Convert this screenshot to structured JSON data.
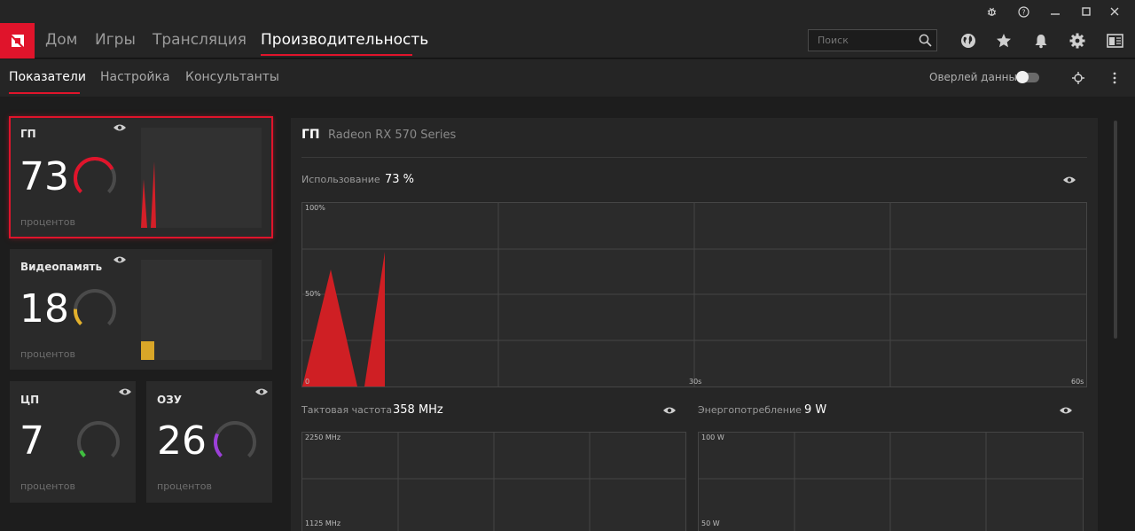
{
  "nav": {
    "items": [
      "Дом",
      "Игры",
      "Трансляция",
      "Производительность"
    ],
    "active": "Производительность"
  },
  "search": {
    "placeholder": "Поиск"
  },
  "subnav": {
    "items": [
      "Показатели",
      "Настройка",
      "Консультанты"
    ],
    "overlay_label": "Оверлей данных"
  },
  "cards": {
    "gpu": {
      "title": "ГП",
      "value": "73",
      "unit": "процентов",
      "percent": 73,
      "color": "#e0142b"
    },
    "vram": {
      "title": "Видеопамять",
      "value": "18",
      "unit": "процентов",
      "percent": 18,
      "color": "#e3b12c"
    },
    "cpu": {
      "title": "ЦП",
      "value": "7",
      "unit": "процентов",
      "percent": 7,
      "color": "#3fbf3f"
    },
    "ram": {
      "title": "ОЗУ",
      "value": "26",
      "unit": "процентов",
      "percent": 26,
      "color": "#9b3fd8"
    }
  },
  "panel": {
    "title": "ГП",
    "device": "Radeon RX 570 Series",
    "usage": {
      "label": "Использование",
      "value": "73 %",
      "y_top": "100%",
      "y_mid": "50%",
      "x_start": "0",
      "x_mid": "30s",
      "x_end": "60s"
    },
    "clock": {
      "label": "Тактовая частота",
      "value": "358 MHz",
      "y_top": "2250 MHz",
      "y_mid": "1125 MHz"
    },
    "power": {
      "label": "Энергопотребление",
      "value": "9 W",
      "y_top": "100 W",
      "y_mid": "50 W"
    }
  },
  "colors": {
    "accent": "#e0142b"
  },
  "icons": [
    "amd-logo-icon",
    "bug-icon",
    "help-icon",
    "minimize-icon",
    "maximize-icon",
    "close-icon",
    "search-icon",
    "globe-icon",
    "star-icon",
    "bell-icon",
    "gear-icon",
    "panel-icon",
    "eye-icon",
    "crosshair-icon",
    "more-vertical-icon"
  ]
}
